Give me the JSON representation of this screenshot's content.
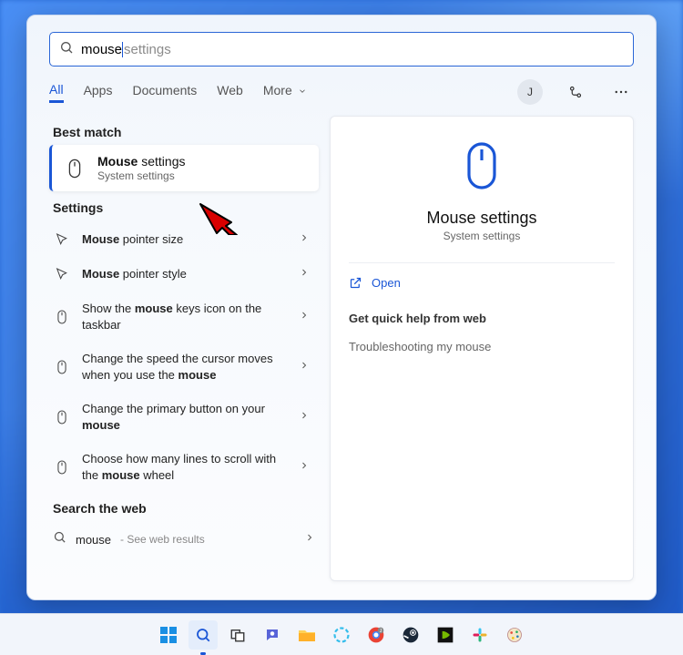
{
  "search": {
    "typed": "mouse",
    "ghost": "settings"
  },
  "tabs": {
    "items": [
      "All",
      "Apps",
      "Documents",
      "Web",
      "More"
    ],
    "active_index": 0,
    "avatar_initial": "J"
  },
  "best_match": {
    "section_title": "Best match",
    "title_bold": "Mouse",
    "title_rest": " settings",
    "subtitle": "System settings"
  },
  "settings": {
    "section_title": "Settings",
    "items": [
      {
        "icon": "pointer",
        "pre": "",
        "bold": "Mouse",
        "post": " pointer size"
      },
      {
        "icon": "pointer",
        "pre": "",
        "bold": "Mouse",
        "post": " pointer style"
      },
      {
        "icon": "mouse",
        "pre": "Show the ",
        "bold": "mouse",
        "post": " keys icon on the taskbar"
      },
      {
        "icon": "mouse",
        "pre": "Change the speed the cursor moves when you use the ",
        "bold": "mouse",
        "post": ""
      },
      {
        "icon": "mouse",
        "pre": "Change the primary button on your ",
        "bold": "mouse",
        "post": ""
      },
      {
        "icon": "mouse",
        "pre": "Choose how many lines to scroll with the ",
        "bold": "mouse",
        "post": " wheel"
      }
    ]
  },
  "web": {
    "section_title": "Search the web",
    "term": "mouse",
    "hint": " - See web results"
  },
  "preview": {
    "title": "Mouse settings",
    "subtitle": "System settings",
    "open_label": "Open",
    "help_title": "Get quick help from web",
    "help_link": "Troubleshooting my mouse"
  }
}
